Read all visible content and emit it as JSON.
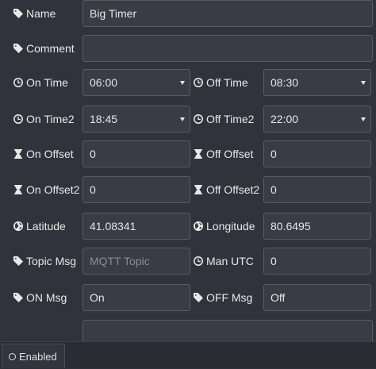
{
  "labels": {
    "name": "Name",
    "comment": "Comment",
    "on_time": "On Time",
    "off_time": "Off Time",
    "on_time2": "On Time2",
    "off_time2": "Off Time2",
    "on_offset": "On Offset",
    "off_offset": "Off Offset",
    "on_offset2": "On Offset2",
    "off_offset2": "Off Offset2",
    "latitude": "Latitude",
    "longitude": "Longitude",
    "topic_msg": "Topic Msg",
    "man_utc": "Man UTC",
    "on_msg": "ON Msg",
    "off_msg": "OFF Msg"
  },
  "values": {
    "name": "Big Timer",
    "comment": "",
    "on_time": "06:00",
    "off_time": "08:30",
    "on_time2": "18:45",
    "off_time2": "22:00",
    "on_offset": "0",
    "off_offset": "0",
    "on_offset2": "0",
    "off_offset2": "0",
    "latitude": "41.08341",
    "longitude": "80.6495",
    "man_utc": "0",
    "on_msg": "On",
    "off_msg": "Off"
  },
  "placeholders": {
    "topic": "MQTT Topic"
  },
  "footer": {
    "enabled_label": "Enabled"
  },
  "icons": {
    "tag": "tag-icon",
    "clock": "clock-icon",
    "hourglass": "hourglass-icon",
    "globe": "globe-icon",
    "circle": "circle-icon"
  }
}
